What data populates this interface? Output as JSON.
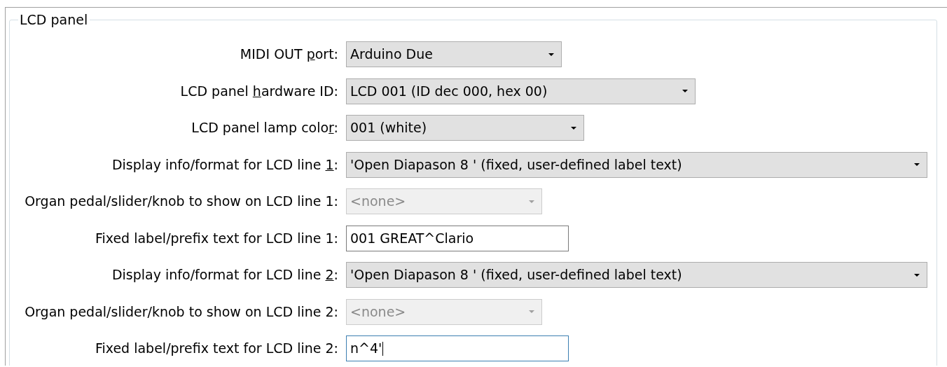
{
  "group": {
    "title": "LCD panel"
  },
  "rows": [
    {
      "kind": "dropdown",
      "label": [
        {
          "text": "MIDI OUT ",
          "underline": false
        },
        {
          "text": "p",
          "underline": true
        },
        {
          "text": "ort:",
          "underline": false
        }
      ],
      "value": "Arduino Due",
      "disabled": false
    },
    {
      "kind": "dropdown",
      "label": [
        {
          "text": "LCD panel ",
          "underline": false
        },
        {
          "text": "h",
          "underline": true
        },
        {
          "text": "ardware ID:",
          "underline": false
        }
      ],
      "value": "LCD 001 (ID dec 000, hex 00)",
      "disabled": false
    },
    {
      "kind": "dropdown",
      "label": [
        {
          "text": "LCD panel lamp colo",
          "underline": false
        },
        {
          "text": "r",
          "underline": true
        },
        {
          "text": ":",
          "underline": false
        }
      ],
      "value": "001 (white)",
      "disabled": false
    },
    {
      "kind": "dropdown",
      "label": [
        {
          "text": "Display info/format for LCD line ",
          "underline": false
        },
        {
          "text": "1",
          "underline": true
        },
        {
          "text": ":",
          "underline": false
        }
      ],
      "value": "'Open Diapason 8 ' (fixed, user-defined label text)",
      "disabled": false
    },
    {
      "kind": "dropdown",
      "label": [
        {
          "text": "Organ pedal/slider/knob to show on LCD line 1:",
          "underline": false
        }
      ],
      "value": "<none>",
      "disabled": true
    },
    {
      "kind": "text",
      "label": [
        {
          "text": "Fixed label/prefix text for LCD line 1:",
          "underline": false
        }
      ],
      "value": "001 GREAT^Clario",
      "focused": false
    },
    {
      "kind": "dropdown",
      "label": [
        {
          "text": "Display info/format for LCD line ",
          "underline": false
        },
        {
          "text": "2",
          "underline": true
        },
        {
          "text": ":",
          "underline": false
        }
      ],
      "value": "'Open Diapason 8 ' (fixed, user-defined label text)",
      "disabled": false
    },
    {
      "kind": "dropdown",
      "label": [
        {
          "text": "Organ pedal/slider/knob to show on LCD line 2:",
          "underline": false
        }
      ],
      "value": "<none>",
      "disabled": true
    },
    {
      "kind": "text",
      "label": [
        {
          "text": "Fixed label/prefix text for LCD line 2:",
          "underline": false
        }
      ],
      "value": "n^4'",
      "focused": true
    }
  ]
}
